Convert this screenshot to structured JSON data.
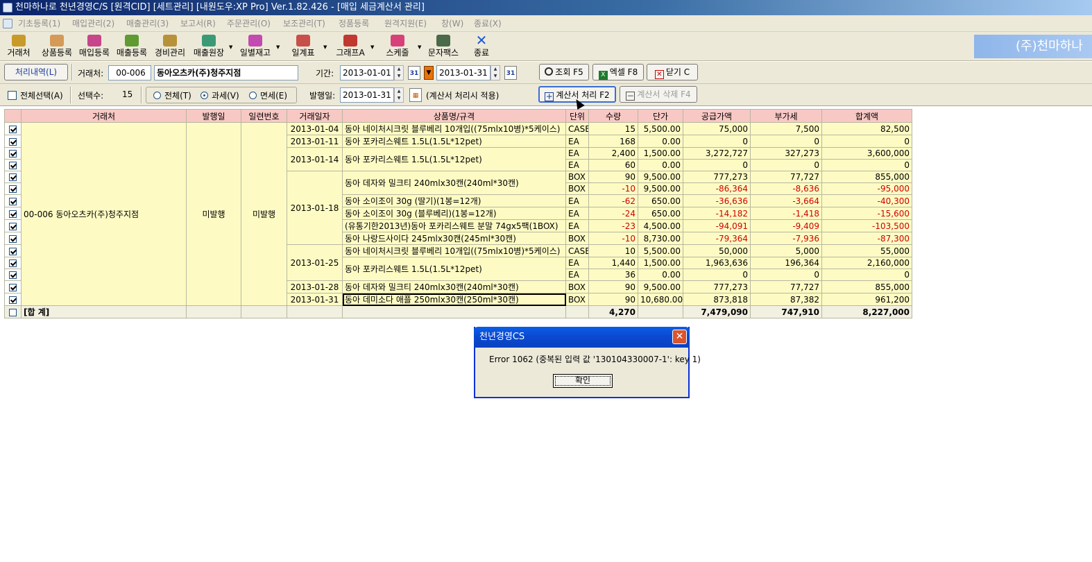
{
  "window": {
    "title": "천마하나로 천년경영C/S [원격CID] [세트관리] [내원도우:XP Pro] Ver.1.82.426 - [매입 세금계산서 관리]"
  },
  "menu": {
    "items": [
      "기초등록(1)",
      "매입관리(2)",
      "매출관리(3)",
      "보고서(R)",
      "주문관리(O)",
      "보조관리(T)",
      "정품등록",
      "원격지원(E)",
      "창(W)",
      "종료(X)"
    ]
  },
  "toolbar": {
    "buttons": [
      {
        "label": "거래처",
        "icon": "people-icon",
        "color": "#c89a2a"
      },
      {
        "label": "상품등록",
        "icon": "box-icon",
        "color": "#d59a58"
      },
      {
        "label": "매입등록",
        "icon": "cart-icon",
        "color": "#c7458a"
      },
      {
        "label": "매출등록",
        "icon": "sales-icon",
        "color": "#5f9a32"
      },
      {
        "label": "경비관리",
        "icon": "money-icon",
        "color": "#b8923a"
      },
      {
        "label": "매출원장",
        "icon": "ledger-icon",
        "color": "#3b9a76"
      },
      {
        "label": "일별재고",
        "icon": "stock-icon",
        "color": "#c24ab0"
      },
      {
        "label": "일계표",
        "icon": "pencil-icon",
        "color": "#c8504a"
      },
      {
        "label": "그래프A",
        "icon": "chart-icon",
        "color": "#c03830"
      },
      {
        "label": "스케줄",
        "icon": "schedule-icon",
        "color": "#d8407a"
      },
      {
        "label": "문자팩스",
        "icon": "phone-icon",
        "color": "#4a6a4a"
      },
      {
        "label": "종료",
        "icon": "close-icon",
        "color": "#1a5ad8"
      }
    ],
    "brand": "(주)천마하나"
  },
  "filter": {
    "history_button": "처리내역(L)",
    "vendor_label": "거래처:",
    "vendor_code": "00-006",
    "vendor_name": "동아오츠카(주)청주지점",
    "period_label": "기간:",
    "date_from": "2013-01-01",
    "date_to": "2013-01-31",
    "calendar_icon_text": "31",
    "search_button": "조회 F5",
    "excel_button": "엑셀 F8",
    "close_button": "닫기 C"
  },
  "options": {
    "select_all_label": "전체선택(A)",
    "selected_count_label": "선택수:",
    "selected_count": "15",
    "radio_all": "전체(T)",
    "radio_taxable": "과세(V)",
    "radio_exempt": "면세(E)",
    "issue_date_label": "발행일:",
    "issue_date": "2013-01-31",
    "apply_note": "(계산서 처리시 적용)",
    "process_button": "계산서 처리 F2",
    "delete_button": "계산서 삭제 F4"
  },
  "grid": {
    "headers": [
      "",
      "거래처",
      "발행일",
      "일련번호",
      "거래일자",
      "상품명/규격",
      "단위",
      "수량",
      "단가",
      "공급가액",
      "부가세",
      "합계액"
    ],
    "group_vendor": "00-006 동아오츠카(주)청주지점",
    "group_issue": "미발행",
    "group_serial": "미발행",
    "rows": [
      {
        "date": "2013-01-04",
        "product": "동아 네이처시크릿 블루베리 10개입((75mlx10병)*5케이스)",
        "unit": "CASE",
        "qty": "15",
        "price": "5,500.00",
        "supply": "75,000",
        "vat": "7,500",
        "total": "82,500"
      },
      {
        "date": "2013-01-11",
        "product": "동아 포카리스웨트 1.5L(1.5L*12pet)",
        "unit": "EA",
        "qty": "168",
        "price": "0.00",
        "supply": "0",
        "vat": "0",
        "total": "0"
      },
      {
        "date": "2013-01-14",
        "product": "동아 포카리스웨트 1.5L(1.5L*12pet)",
        "unit": "EA",
        "qty": "2,400",
        "price": "1,500.00",
        "supply": "3,272,727",
        "vat": "327,273",
        "total": "3,600,000"
      },
      {
        "date": "",
        "product": "",
        "unit": "EA",
        "qty": "60",
        "price": "0.00",
        "supply": "0",
        "vat": "0",
        "total": "0"
      },
      {
        "date": "2013-01-18",
        "product": "동아 데자와 밀크티 240mlx30캔(240ml*30캔)",
        "unit": "BOX",
        "qty": "90",
        "price": "9,500.00",
        "supply": "777,273",
        "vat": "77,727",
        "total": "855,000"
      },
      {
        "date": "",
        "product": "",
        "unit": "BOX",
        "qty": "-10",
        "price": "9,500.00",
        "supply": "-86,364",
        "vat": "-8,636",
        "total": "-95,000"
      },
      {
        "date": "",
        "product": "동아 소이조이 30g (딸기)(1봉=12개)",
        "unit": "EA",
        "qty": "-62",
        "price": "650.00",
        "supply": "-36,636",
        "vat": "-3,664",
        "total": "-40,300"
      },
      {
        "date": "",
        "product": "동아 소이조이 30g (블루베리)(1봉=12개)",
        "unit": "EA",
        "qty": "-24",
        "price": "650.00",
        "supply": "-14,182",
        "vat": "-1,418",
        "total": "-15,600"
      },
      {
        "date": "",
        "product": "(유통기한2013년)동아 포카리스웨트 분말 74gx5팩(1BOX)",
        "unit": "EA",
        "qty": "-23",
        "price": "4,500.00",
        "supply": "-94,091",
        "vat": "-9,409",
        "total": "-103,500"
      },
      {
        "date": "",
        "product": "동아 나랑드사이다 245mlx30캔(245ml*30캔)",
        "unit": "BOX",
        "qty": "-10",
        "price": "8,730.00",
        "supply": "-79,364",
        "vat": "-7,936",
        "total": "-87,300"
      },
      {
        "date": "2013-01-25",
        "product": "동아 네이처시크릿 블루베리 10개입((75mlx10병)*5케이스)",
        "unit": "CASE",
        "qty": "10",
        "price": "5,500.00",
        "supply": "50,000",
        "vat": "5,000",
        "total": "55,000"
      },
      {
        "date": "",
        "product": "동아 포카리스웨트 1.5L(1.5L*12pet)",
        "unit": "EA",
        "qty": "1,440",
        "price": "1,500.00",
        "supply": "1,963,636",
        "vat": "196,364",
        "total": "2,160,000"
      },
      {
        "date": "",
        "product": "",
        "unit": "EA",
        "qty": "36",
        "price": "0.00",
        "supply": "0",
        "vat": "0",
        "total": "0"
      },
      {
        "date": "2013-01-28",
        "product": "동아 데자와 밀크티 240mlx30캔(240ml*30캔)",
        "unit": "BOX",
        "qty": "90",
        "price": "9,500.00",
        "supply": "777,273",
        "vat": "77,727",
        "total": "855,000"
      },
      {
        "date": "2013-01-31",
        "product": "동아 데미소다 애플 250mlx30캔(250ml*30캔)",
        "unit": "BOX",
        "qty": "90",
        "price": "10,680.00",
        "supply": "873,818",
        "vat": "87,382",
        "total": "961,200"
      }
    ],
    "total_label": "[합 계]",
    "total_qty": "4,270",
    "total_supply": "7,479,090",
    "total_vat": "747,910",
    "total_sum": "8,227,000"
  },
  "dialog": {
    "title": "천년경영CS",
    "message": "Error 1062 (중복된 입력 값 '130104330007-1': key 1)",
    "ok_button": "확인"
  },
  "colors": {
    "header_bg": "#f8c8c4",
    "row_bg": "#fdfbc3",
    "negative": "#d00000"
  }
}
